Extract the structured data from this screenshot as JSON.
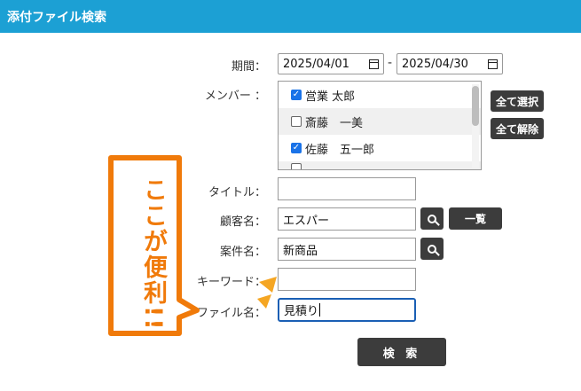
{
  "header": {
    "title": "添付ファイル検索"
  },
  "form": {
    "period": {
      "label": "期間：",
      "from": "2025/04/01",
      "separator": "-",
      "to": "2025/04/30"
    },
    "members": {
      "label": "メンバー ：",
      "items": [
        {
          "name": "営業 太郎",
          "checked": true
        },
        {
          "name": "斎藤　一美",
          "checked": false
        },
        {
          "name": "佐藤　五一郎",
          "checked": true
        }
      ],
      "select_all_label": "全て選択",
      "clear_all_label": "全て解除"
    },
    "title": {
      "label": "タイトル：",
      "value": ""
    },
    "customer": {
      "label": "顧客名：",
      "value": "エスパー",
      "list_label": "一覧"
    },
    "project": {
      "label": "案件名：",
      "value": "新商品"
    },
    "keyword": {
      "label": "キーワード：",
      "value": ""
    },
    "filename": {
      "label": "ファイル名：",
      "value": "見積り"
    },
    "submit_label": "検 索"
  },
  "annotation": {
    "text": "ここが便利!!",
    "color": "#f07a0a"
  },
  "colors": {
    "header": "#1ca0d4",
    "button": "#3c3c3c",
    "checkbox": "#1a73e8"
  }
}
